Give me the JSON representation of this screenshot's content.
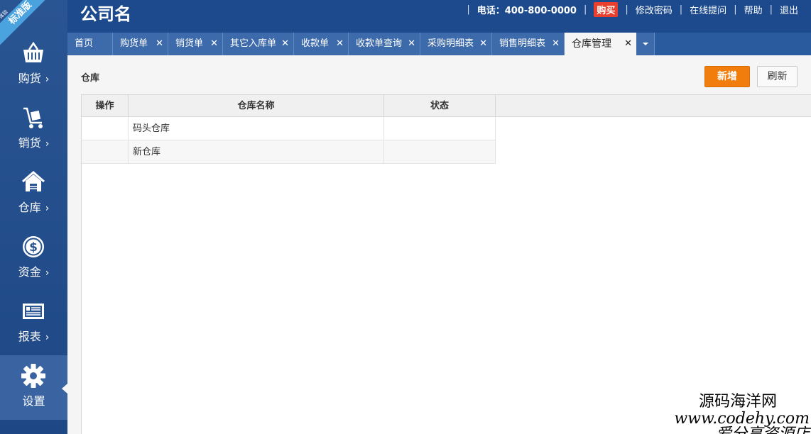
{
  "edition": {
    "small": "体验",
    "label": "标准版"
  },
  "header": {
    "company": "公司名",
    "phone": "电话：400-800-0000",
    "buy": "购买",
    "change_password": "修改密码",
    "online_help": "在线提问",
    "help": "帮助",
    "logout": "退出"
  },
  "sidebar": {
    "items": [
      {
        "label": "购货",
        "icon": "basket-icon"
      },
      {
        "label": "销货",
        "icon": "cart-icon"
      },
      {
        "label": "仓库",
        "icon": "warehouse-icon"
      },
      {
        "label": "资金",
        "icon": "dollar-icon"
      },
      {
        "label": "报表",
        "icon": "report-icon"
      },
      {
        "label": "设置",
        "icon": "gear-icon"
      }
    ],
    "active": "设置",
    "chevron": "›"
  },
  "tabs": [
    {
      "label": "首页"
    },
    {
      "label": "购货单"
    },
    {
      "label": "销货单"
    },
    {
      "label": "其它入库单"
    },
    {
      "label": "收款单"
    },
    {
      "label": "收款单查询"
    },
    {
      "label": "采购明细表"
    },
    {
      "label": "销售明细表"
    },
    {
      "label": "仓库管理"
    }
  ],
  "close_glyph": "✕",
  "page": {
    "title": "仓库",
    "add_button": "新增",
    "refresh_button": "刷新"
  },
  "table": {
    "columns": [
      "操作",
      "仓库名称",
      "状态"
    ],
    "rows": [
      {
        "action": "",
        "name": "码头仓库",
        "status": ""
      },
      {
        "action": "",
        "name": "新仓库",
        "status": ""
      }
    ]
  },
  "watermark": {
    "line1": "源码海洋网",
    "line2": "www.codehy.com",
    "line3": "爱分享资源店"
  },
  "colors": {
    "sidebar": "#1d4785",
    "header": "#1c4a8c",
    "accent_orange": "#f07d0c",
    "buy_red": "#e8402d"
  }
}
